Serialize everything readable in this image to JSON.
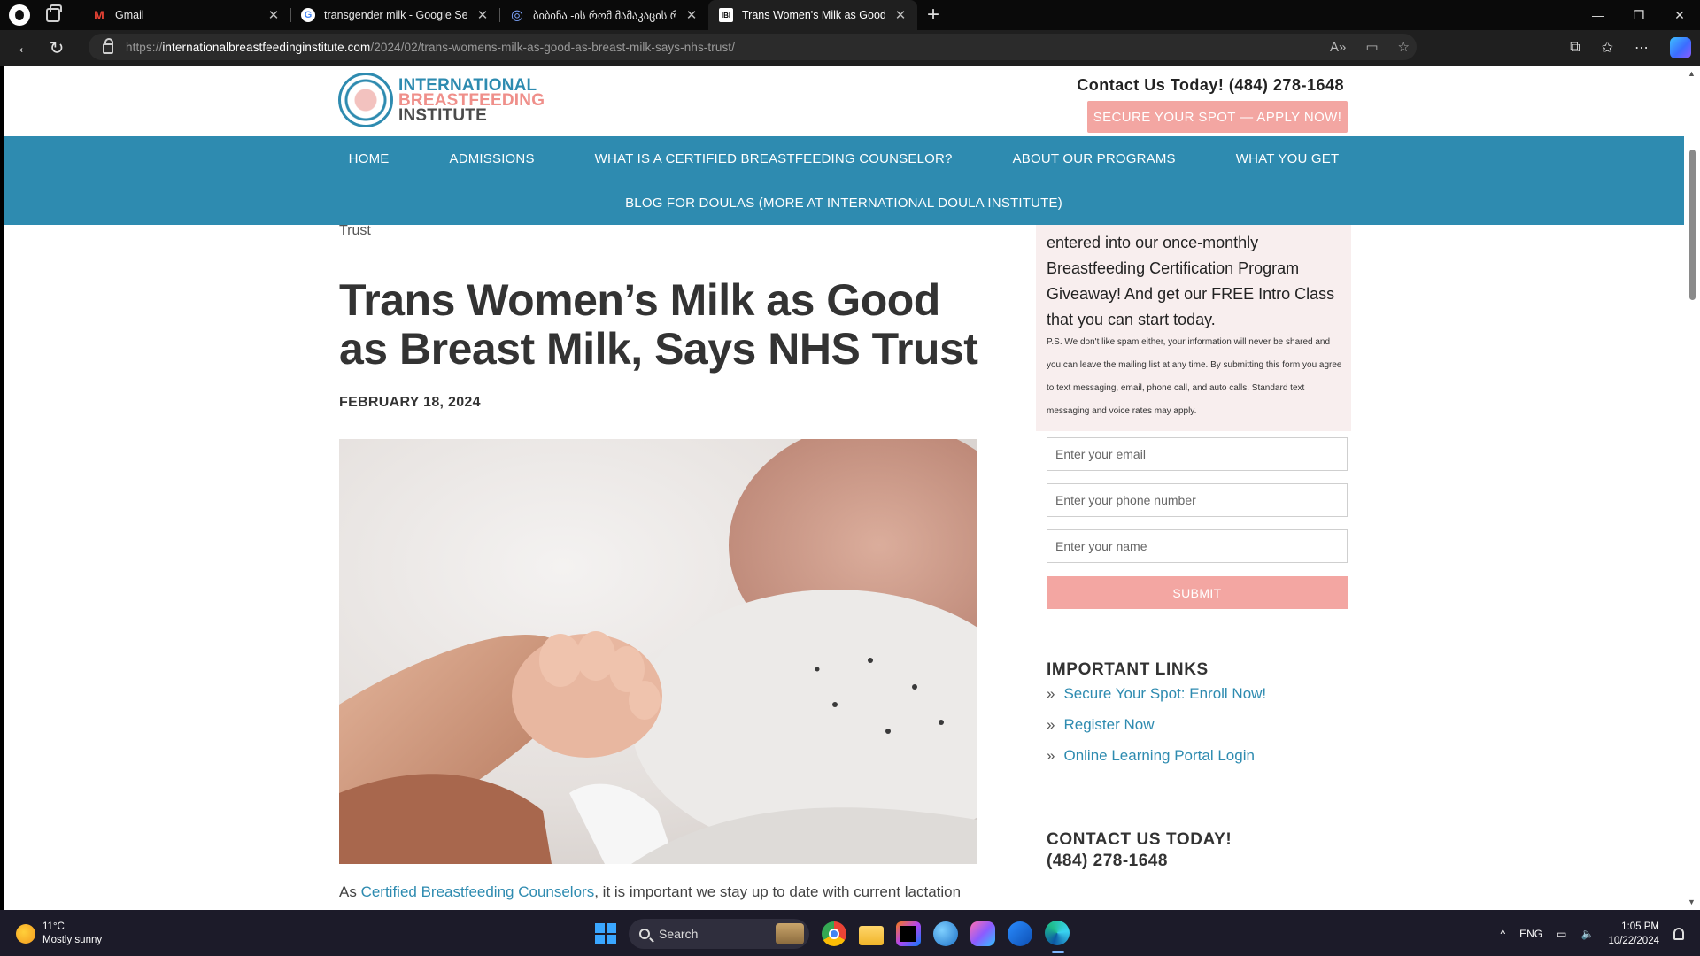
{
  "browser": {
    "tabs": [
      {
        "title": "Gmail",
        "favicon": "gmail-icon",
        "active": false
      },
      {
        "title": "transgender milk - Google Search",
        "favicon": "google-icon",
        "active": false
      },
      {
        "title": "ბიბინა -ის რომ მამაკაცის რძ",
        "favicon": "globe-icon",
        "active": false
      },
      {
        "title": "Trans Women's Milk as Good as B",
        "favicon": "ibi-icon",
        "active": true
      }
    ],
    "url_prefix": "https://",
    "url_host": "internationalbreastfeedinginstitute.com",
    "url_path": "/2024/02/trans-womens-milk-as-good-as-breast-milk-says-nhs-trust/"
  },
  "site": {
    "logo": {
      "line1": "INTERNATIONAL",
      "line2": "BREASTFEEDING",
      "line3": "INSTITUTE"
    },
    "contact": "Contact Us Today! (484) 278-1648",
    "apply_button": "SECURE YOUR SPOT — APPLY NOW!",
    "nav_row1": [
      "HOME",
      "ADMISSIONS",
      "WHAT IS A CERTIFIED BREASTFEEDING COUNSELOR?",
      "ABOUT OUR PROGRAMS",
      "WHAT YOU GET"
    ],
    "nav_row2": [
      "BLOG FOR DOULAS (MORE AT INTERNATIONAL DOULA INSTITUTE)"
    ],
    "brand_blue": "#2e8bb0",
    "brand_pink": "#f3a6a2"
  },
  "article": {
    "breadcrumb_tail": "Trust",
    "title": "Trans Women’s Milk as Good as Breast Milk, Says NHS Trust",
    "date": "FEBRUARY 18, 2024",
    "intro_prefix": "As ",
    "intro_link": "Certified Breastfeeding Counselors",
    "intro_suffix": ", it is important we stay up to date with current lactation"
  },
  "sidebar": {
    "signup_text": "entered into our once-monthly Breastfeeding Certification Program Giveaway! And get our FREE Intro Class that you can start today.",
    "disclaimer": "P.S. We don't like spam either, your information will never be shared and you can leave the mailing list at any time. By submitting this form you agree to text messaging, email, phone call, and auto calls. Standard text messaging and voice rates may apply.",
    "email_placeholder": "Enter your email",
    "phone_placeholder": "Enter your phone number",
    "name_placeholder": "Enter your name",
    "submit_label": "SUBMIT",
    "links_heading": "IMPORTANT LINKS",
    "links": [
      "Secure Your Spot: Enroll Now!",
      "Register Now",
      "Online Learning Portal Login"
    ],
    "contact_heading": "CONTACT US TODAY!",
    "contact_phone": "(484) 278-1648"
  },
  "taskbar": {
    "temperature": "11°C",
    "weather": "Mostly sunny",
    "search_label": "Search",
    "language": "ENG",
    "time": "1:05 PM",
    "date": "10/22/2024"
  }
}
